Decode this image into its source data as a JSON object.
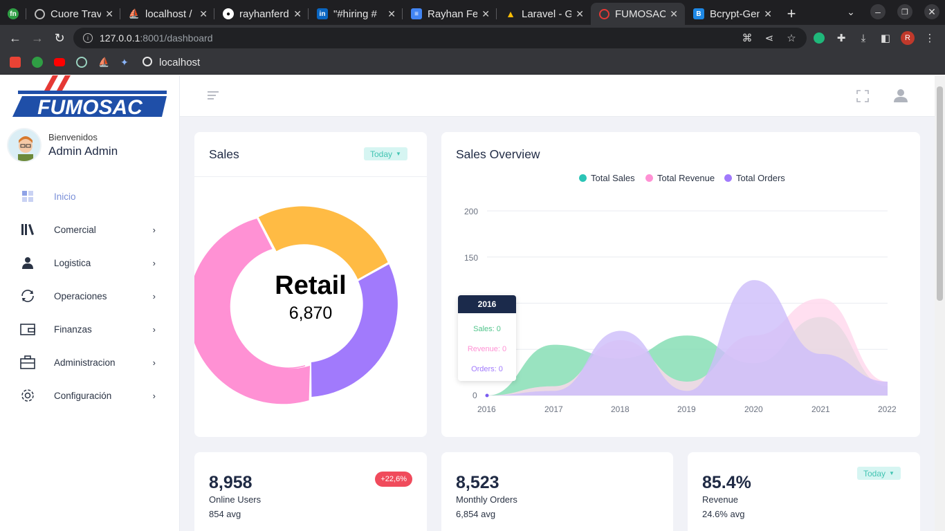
{
  "browser": {
    "tabs": [
      {
        "title": "",
        "favicon": "fn-icon",
        "color": "#2f9e44",
        "pinned": true
      },
      {
        "title": "Cuore Trav",
        "favicon": "globe-icon",
        "color": "#5f6368"
      },
      {
        "title": "localhost /",
        "favicon": "phpmyadmin-icon",
        "color": "#f0a30a"
      },
      {
        "title": "rayhanferd",
        "favicon": "github-icon",
        "color": "#ffffff"
      },
      {
        "title": "\"#hiring #",
        "favicon": "linkedin-icon",
        "color": "#0a66c2"
      },
      {
        "title": "Rayhan Fe",
        "favicon": "docs-icon",
        "color": "#4285f4"
      },
      {
        "title": "Laravel - G",
        "favicon": "drive-icon",
        "color": "#fbbc04"
      },
      {
        "title": "FUMOSAC",
        "favicon": "fumosac-icon",
        "color": "#e53935",
        "active": true
      },
      {
        "title": "Bcrypt-Gen",
        "favicon": "bcrypt-icon",
        "color": "#1e88e5"
      }
    ],
    "new_tab": "+",
    "url_host": "127.0.0.1",
    "url_path": ":8001/dashboard",
    "profile_initial": "R",
    "bookmark_label": "localhost"
  },
  "sidebar": {
    "logo_text": "FUMOSAC",
    "welcome": "Bienvenidos",
    "user_name": "Admin Admin",
    "items": [
      {
        "label": "Inicio",
        "icon": "dashboard-icon",
        "active": true
      },
      {
        "label": "Comercial",
        "icon": "books-icon"
      },
      {
        "label": "Logistica",
        "icon": "user-icon"
      },
      {
        "label": "Operaciones",
        "icon": "sync-icon"
      },
      {
        "label": "Finanzas",
        "icon": "wallet-icon"
      },
      {
        "label": "Administracion",
        "icon": "briefcase-icon"
      },
      {
        "label": "Configuración",
        "icon": "gear-icon"
      }
    ]
  },
  "sales_card": {
    "title": "Sales",
    "filter": "Today",
    "center_label": "Retail",
    "center_value": "6,870",
    "colors": {
      "yellow": "#ffbb44",
      "purple": "#a17afc",
      "pink": "#ff91d4"
    }
  },
  "overview": {
    "title": "Sales Overview",
    "legend": [
      {
        "label": "Total Sales",
        "color": "#2bc4b6"
      },
      {
        "label": "Total Revenue",
        "color": "#ff91d4"
      },
      {
        "label": "Total Orders",
        "color": "#a17afc"
      }
    ],
    "tooltip": {
      "year": "2016",
      "sales": "Sales: 0",
      "revenue": "Revenue: 0",
      "orders": "Orders: 0"
    }
  },
  "chart_data": {
    "type": "area",
    "title": "Sales Overview",
    "x": [
      "2016",
      "2017",
      "2018",
      "2019",
      "2020",
      "2021",
      "2022"
    ],
    "yticks": [
      "0",
      "150",
      "200"
    ],
    "ylim": [
      0,
      200
    ],
    "grid": true,
    "legend_position": "top",
    "series": [
      {
        "name": "Total Sales",
        "values": [
          0,
          55,
          40,
          65,
          35,
          85,
          10
        ],
        "color": "#7fdcb0"
      },
      {
        "name": "Total Revenue",
        "values": [
          0,
          10,
          60,
          15,
          65,
          105,
          15
        ],
        "color": "#ffd7ec"
      },
      {
        "name": "Total Orders",
        "values": [
          0,
          5,
          70,
          5,
          125,
          45,
          15
        ],
        "color": "#cdbdfa"
      }
    ]
  },
  "stats": [
    {
      "value": "8,958",
      "label": "Online Users",
      "avg": "854 avg",
      "badge": "+22,6%"
    },
    {
      "value": "8,523",
      "label": "Monthly Orders",
      "avg": "6,854 avg"
    },
    {
      "value": "85.4%",
      "label": "Revenue",
      "avg": "24.6% avg",
      "filter": "Today"
    }
  ]
}
